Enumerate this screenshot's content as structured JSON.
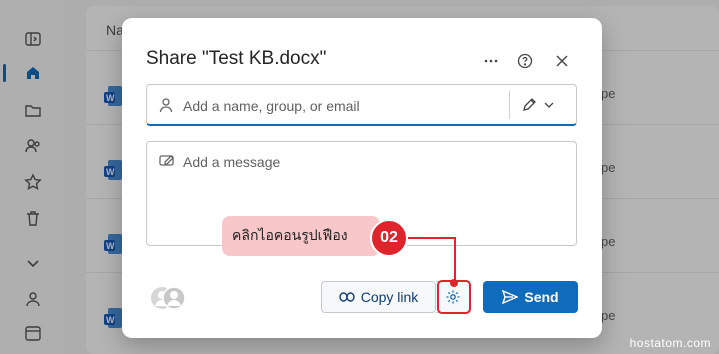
{
  "background": {
    "list_header": "Na",
    "row_tail_text": "pe"
  },
  "dialog": {
    "title": "Share \"Test KB.docx\"",
    "header_icons": [
      "more-icon",
      "help-icon",
      "close-icon"
    ],
    "to_field": {
      "placeholder": "Add a name, group, or email",
      "value": ""
    },
    "message_field": {
      "placeholder": "Add a message",
      "value": ""
    },
    "copy_link_label": "Copy link",
    "send_label": "Send"
  },
  "annotation": {
    "callout_text": "คลิกไอคอนรูปเฟือง",
    "step_number": "02"
  },
  "watermark": "hostatom.com",
  "colors": {
    "accent": "#0f6cbd",
    "annotation_red": "#e0242b",
    "callout_bg": "#f7c7c9"
  }
}
